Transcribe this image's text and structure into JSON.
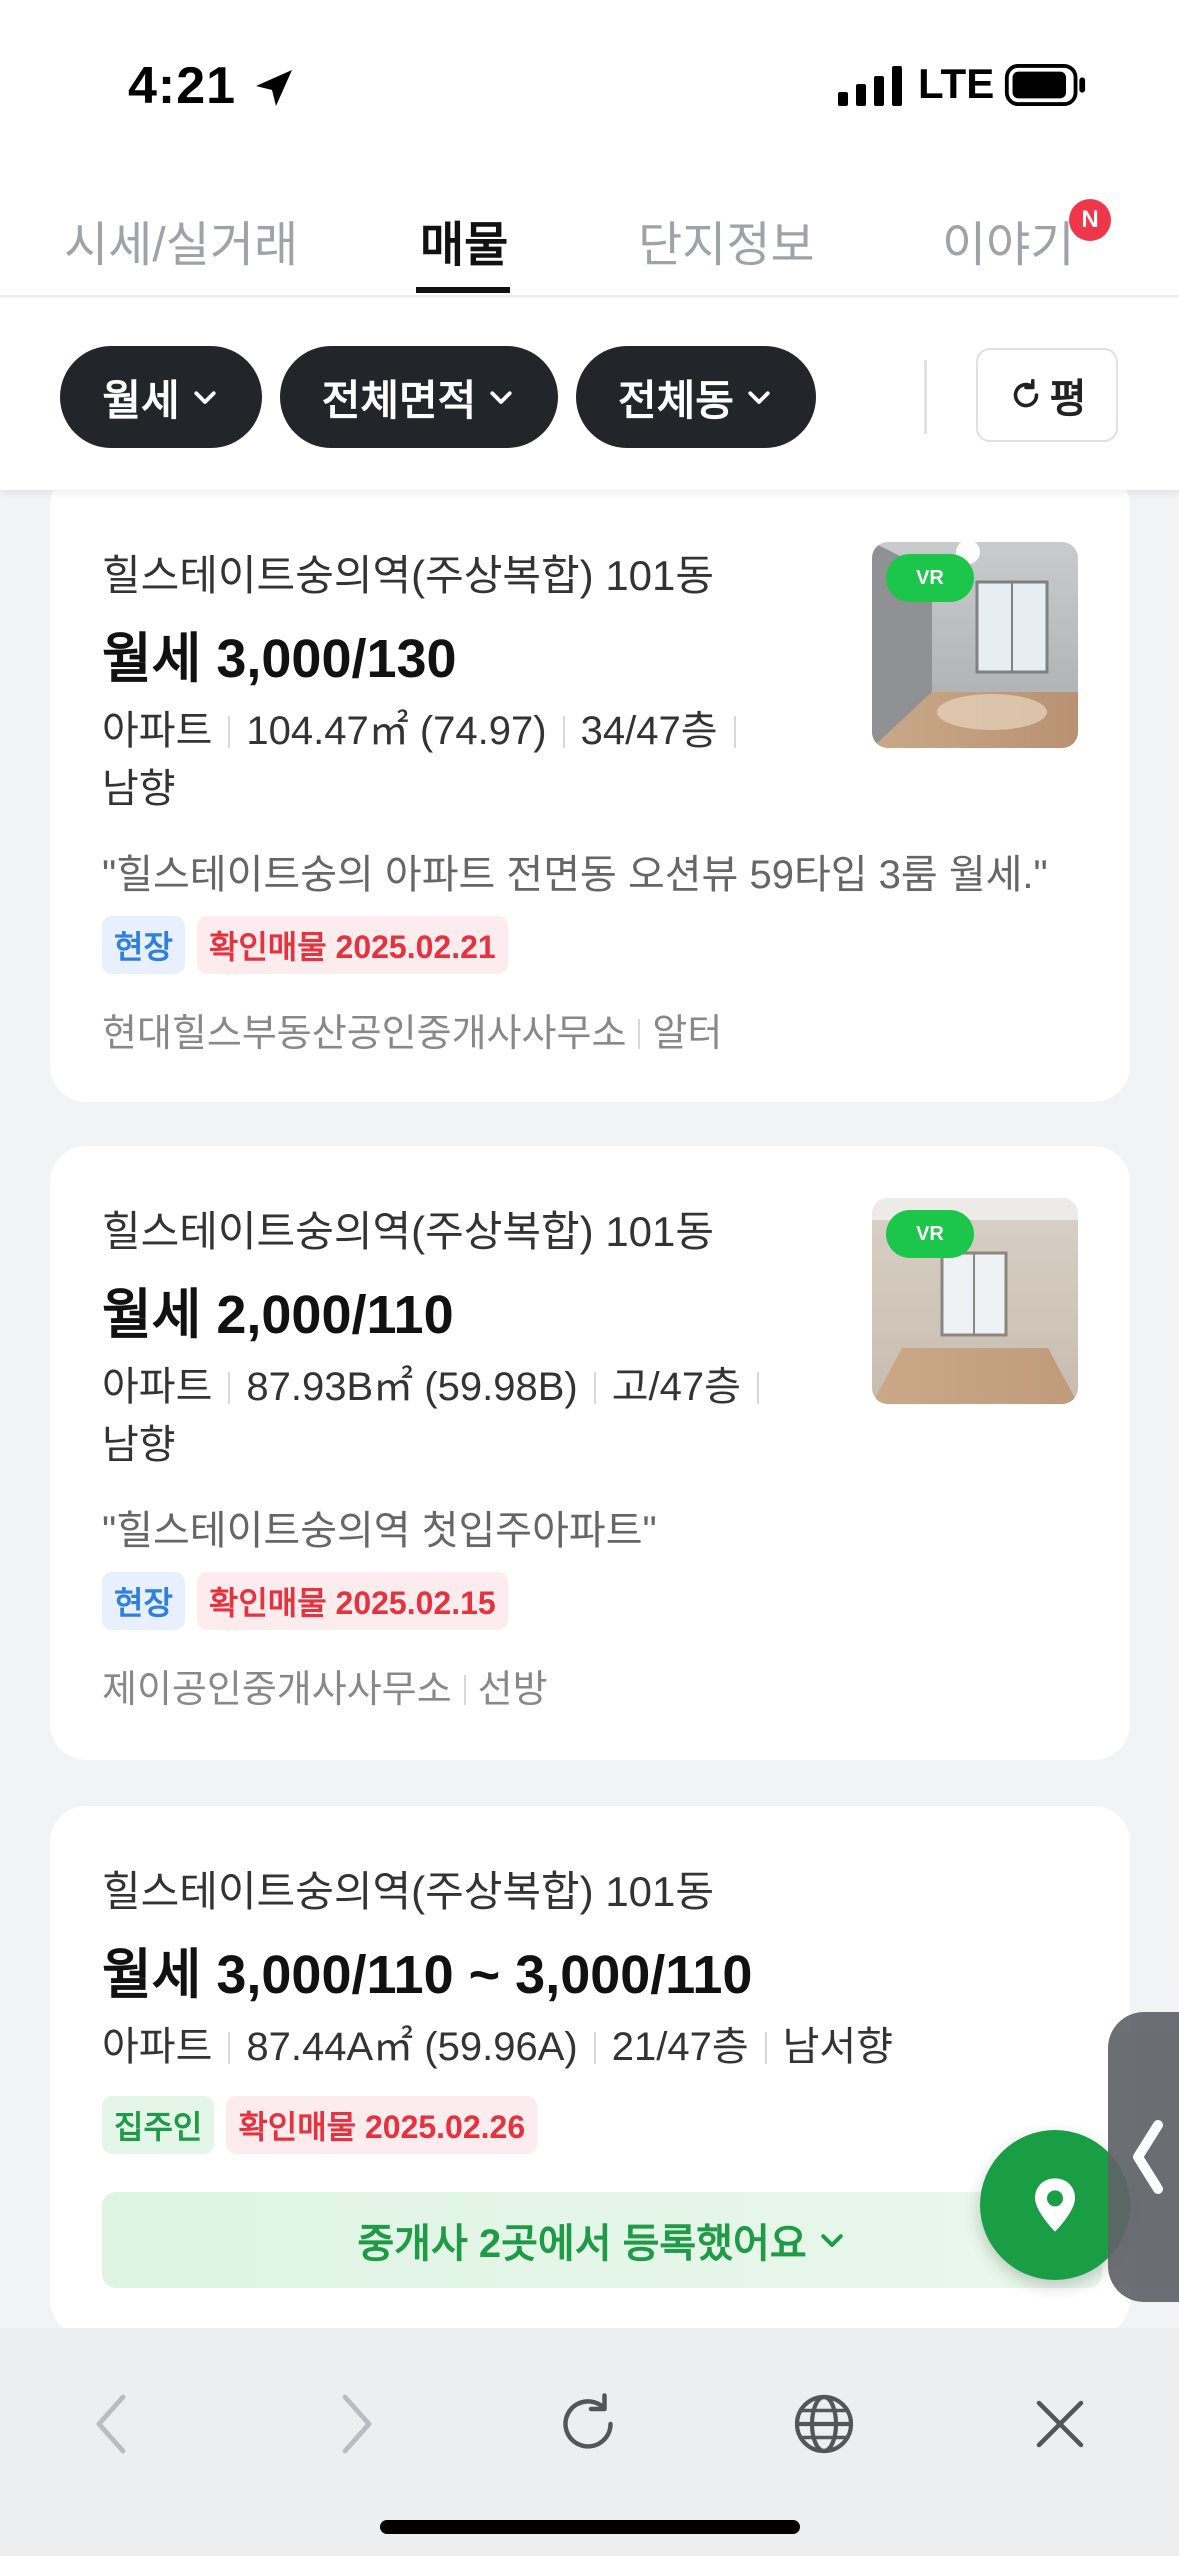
{
  "status": {
    "time": "4:21",
    "network": "LTE"
  },
  "tabs": [
    {
      "label": "시세/실거래",
      "active": false
    },
    {
      "label": "매물",
      "active": true
    },
    {
      "label": "단지정보",
      "active": false
    },
    {
      "label": "이야기",
      "active": false,
      "badge": "N"
    }
  ],
  "filters": {
    "chips": [
      {
        "label": "월세",
        "icon": "chevron-down-icon"
      },
      {
        "label": "전체면적",
        "icon": "chevron-down-icon"
      },
      {
        "label": "전체동",
        "icon": "chevron-down-icon"
      }
    ],
    "unit_button": {
      "label": "평",
      "icon": "refresh-icon"
    }
  },
  "listings": [
    {
      "title": "힐스테이트숭의역(주상복합) 101동",
      "price": "월세 3,000/130",
      "type": "아파트",
      "area": "104.47㎡ (74.97)",
      "floor": "34/47층",
      "direction": "남향",
      "description": "\"힐스테이트숭의 아파트 전면동 오션뷰 59타입 3룸 월세.\"",
      "badge_source": "현장",
      "badge_verified": "확인매물 2025.02.21",
      "agent": "현대힐스부동산공인중개사사무소",
      "agent_source": "알터",
      "vr_label": "VR"
    },
    {
      "title": "힐스테이트숭의역(주상복합) 101동",
      "price": "월세 2,000/110",
      "type": "아파트",
      "area": "87.93B㎡ (59.98B)",
      "floor": "고/47층",
      "direction": "남향",
      "description": "\"힐스테이트숭의역 첫입주아파트\"",
      "badge_source": "현장",
      "badge_verified": "확인매물 2025.02.15",
      "agent": "제이공인중개사사무소",
      "agent_source": "선방",
      "vr_label": "VR"
    },
    {
      "title": "힐스테이트숭의역(주상복합) 101동",
      "price": "월세 3,000/110 ~ 3,000/110",
      "type": "아파트",
      "area": "87.44A㎡ (59.96A)",
      "floor": "21/47층",
      "direction": "남서향",
      "badge_source": "집주인",
      "badge_verified": "확인매물 2025.02.26",
      "brokers_text": "중개사 2곳에서 등록했어요"
    }
  ],
  "colors": {
    "chip_bg": "#22262b",
    "accent_green": "#1a9e45",
    "verified_red": "#e5323f",
    "source_blue": "#2f7fe0"
  }
}
